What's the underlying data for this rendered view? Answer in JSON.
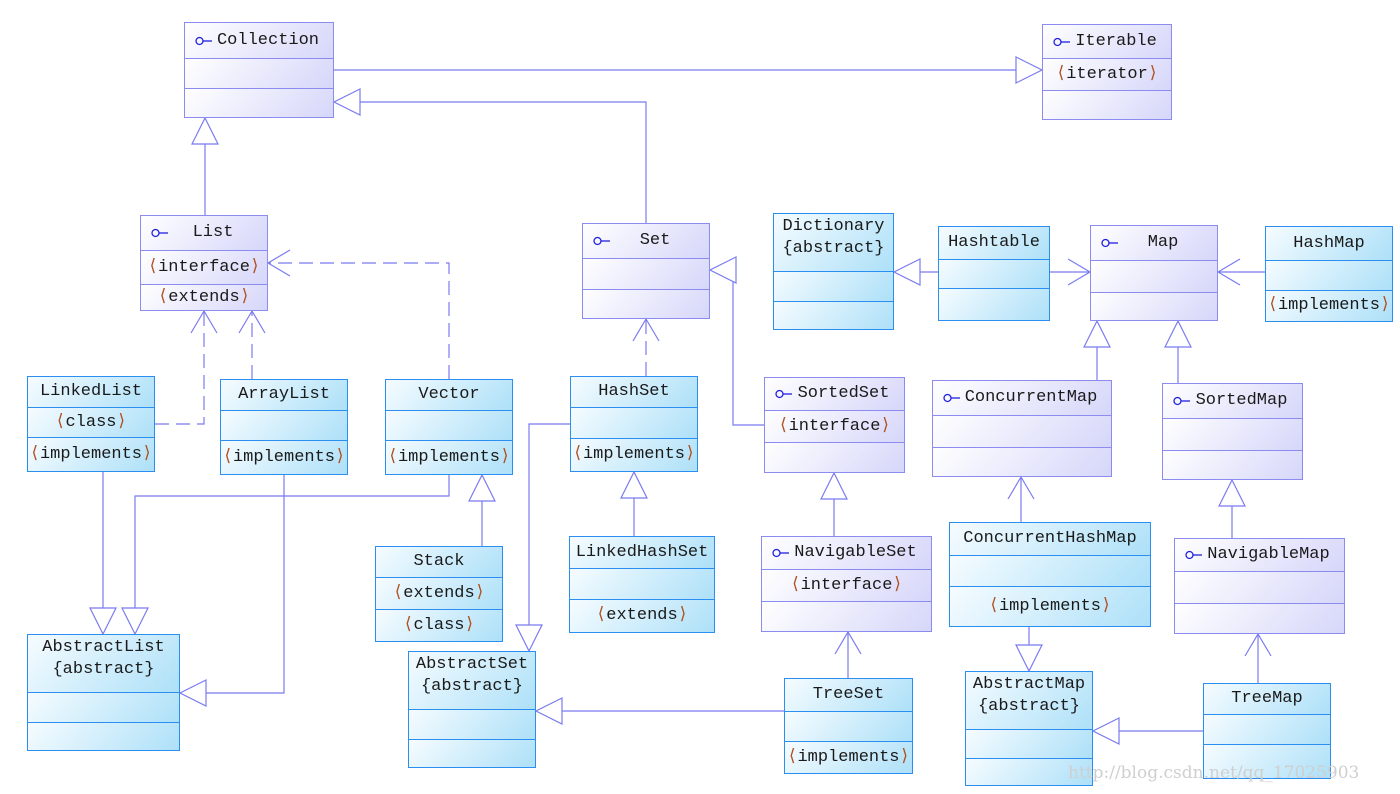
{
  "colors": {
    "interface_border": "#8c8cf0",
    "class_border": "#2a8ff0",
    "edge": "#7b7bf0",
    "stereotype_bracket": "#b0501e"
  },
  "boxes": {
    "collection": {
      "kind": "interface",
      "title": "Collection",
      "rows": [
        "",
        ""
      ]
    },
    "iterable": {
      "kind": "interface",
      "title": "Iterable",
      "rows": [
        "iterator",
        ""
      ]
    },
    "list": {
      "kind": "interface",
      "title": "List",
      "rows": [
        "interface",
        "extends"
      ]
    },
    "set": {
      "kind": "interface",
      "title": "Set",
      "rows": [
        "",
        ""
      ]
    },
    "dictionary": {
      "kind": "class",
      "title": "Dictionary",
      "subtitle": "{abstract}",
      "rows": [
        "",
        ""
      ]
    },
    "hashtable": {
      "kind": "class",
      "title": "Hashtable",
      "rows": [
        "",
        ""
      ]
    },
    "map": {
      "kind": "interface",
      "title": "Map",
      "rows": [
        "",
        ""
      ]
    },
    "hashmap": {
      "kind": "class",
      "title": "HashMap",
      "rows": [
        "",
        "implements"
      ]
    },
    "linkedlist": {
      "kind": "class",
      "title": "LinkedList",
      "rows": [
        "class",
        "implements"
      ]
    },
    "arraylist": {
      "kind": "class",
      "title": "ArrayList",
      "rows": [
        "",
        "implements"
      ]
    },
    "vector": {
      "kind": "class",
      "title": "Vector",
      "rows": [
        "",
        "implements"
      ]
    },
    "hashset": {
      "kind": "class",
      "title": "HashSet",
      "rows": [
        "",
        "implements"
      ]
    },
    "sortedset": {
      "kind": "interface",
      "title": "SortedSet",
      "rows": [
        "interface",
        ""
      ]
    },
    "concurrentmap": {
      "kind": "interface",
      "title": "ConcurrentMap",
      "rows": [
        "",
        ""
      ]
    },
    "sortedmap": {
      "kind": "interface",
      "title": "SortedMap",
      "rows": [
        "",
        ""
      ]
    },
    "stack": {
      "kind": "class",
      "title": "Stack",
      "rows": [
        "extends",
        "class"
      ]
    },
    "linkedhashset": {
      "kind": "class",
      "title": "LinkedHashSet",
      "rows": [
        "",
        "extends"
      ]
    },
    "navigableset": {
      "kind": "interface",
      "title": "NavigableSet",
      "rows": [
        "interface",
        ""
      ]
    },
    "concurrenthashmap": {
      "kind": "class",
      "title": "ConcurrentHashMap",
      "rows": [
        "",
        "implements"
      ]
    },
    "navigablemap": {
      "kind": "interface",
      "title": "NavigableMap",
      "rows": [
        "",
        ""
      ]
    },
    "abstractlist": {
      "kind": "class",
      "title": "AbstractList",
      "subtitle": "{abstract}",
      "rows": [
        "",
        ""
      ]
    },
    "abstractset": {
      "kind": "class",
      "title": "AbstractSet",
      "subtitle": "{abstract}",
      "rows": [
        "",
        ""
      ]
    },
    "treeset": {
      "kind": "class",
      "title": "TreeSet",
      "rows": [
        "",
        "implements"
      ]
    },
    "abstractmap": {
      "kind": "class",
      "title": "AbstractMap",
      "subtitle": "{abstract}",
      "rows": [
        "",
        ""
      ]
    },
    "treemap": {
      "kind": "class",
      "title": "TreeMap",
      "rows": [
        "",
        ""
      ]
    }
  },
  "relations": [
    {
      "from": "collection",
      "to": "iterable",
      "type": "generalization"
    },
    {
      "from": "set",
      "to": "collection",
      "type": "generalization"
    },
    {
      "from": "list",
      "to": "collection",
      "type": "generalization"
    },
    {
      "from": "vector",
      "to": "list",
      "type": "realization"
    },
    {
      "from": "linkedlist",
      "to": "list",
      "type": "realization"
    },
    {
      "from": "arraylist",
      "to": "list",
      "type": "realization"
    },
    {
      "from": "hashset",
      "to": "set",
      "type": "realization"
    },
    {
      "from": "sortedset",
      "to": "set",
      "type": "generalization"
    },
    {
      "from": "hashtable",
      "to": "dictionary",
      "type": "generalization"
    },
    {
      "from": "hashtable",
      "to": "map",
      "type": "association"
    },
    {
      "from": "hashmap",
      "to": "map",
      "type": "association"
    },
    {
      "from": "concurrentmap",
      "to": "map",
      "type": "generalization"
    },
    {
      "from": "sortedmap",
      "to": "map",
      "type": "generalization"
    },
    {
      "from": "linkedlist",
      "to": "abstractlist",
      "type": "generalization"
    },
    {
      "from": "vector",
      "to": "abstractlist",
      "type": "generalization"
    },
    {
      "from": "arraylist",
      "to": "abstractlist",
      "type": "generalization"
    },
    {
      "from": "stack",
      "to": "vector",
      "type": "generalization"
    },
    {
      "from": "hashset",
      "to": "abstractset",
      "type": "generalization"
    },
    {
      "from": "linkedhashset",
      "to": "hashset",
      "type": "generalization"
    },
    {
      "from": "navigableset",
      "to": "sortedset",
      "type": "generalization"
    },
    {
      "from": "treeset",
      "to": "navigableset",
      "type": "association"
    },
    {
      "from": "treeset",
      "to": "abstractset",
      "type": "generalization"
    },
    {
      "from": "concurrenthashmap",
      "to": "concurrentmap",
      "type": "association"
    },
    {
      "from": "concurrenthashmap",
      "to": "abstractmap",
      "type": "generalization"
    },
    {
      "from": "navigablemap",
      "to": "sortedmap",
      "type": "generalization"
    },
    {
      "from": "treemap",
      "to": "navigablemap",
      "type": "association"
    },
    {
      "from": "treemap",
      "to": "abstractmap",
      "type": "generalization"
    }
  ],
  "watermark": "http://blog.csdn.net/qq_17025903"
}
